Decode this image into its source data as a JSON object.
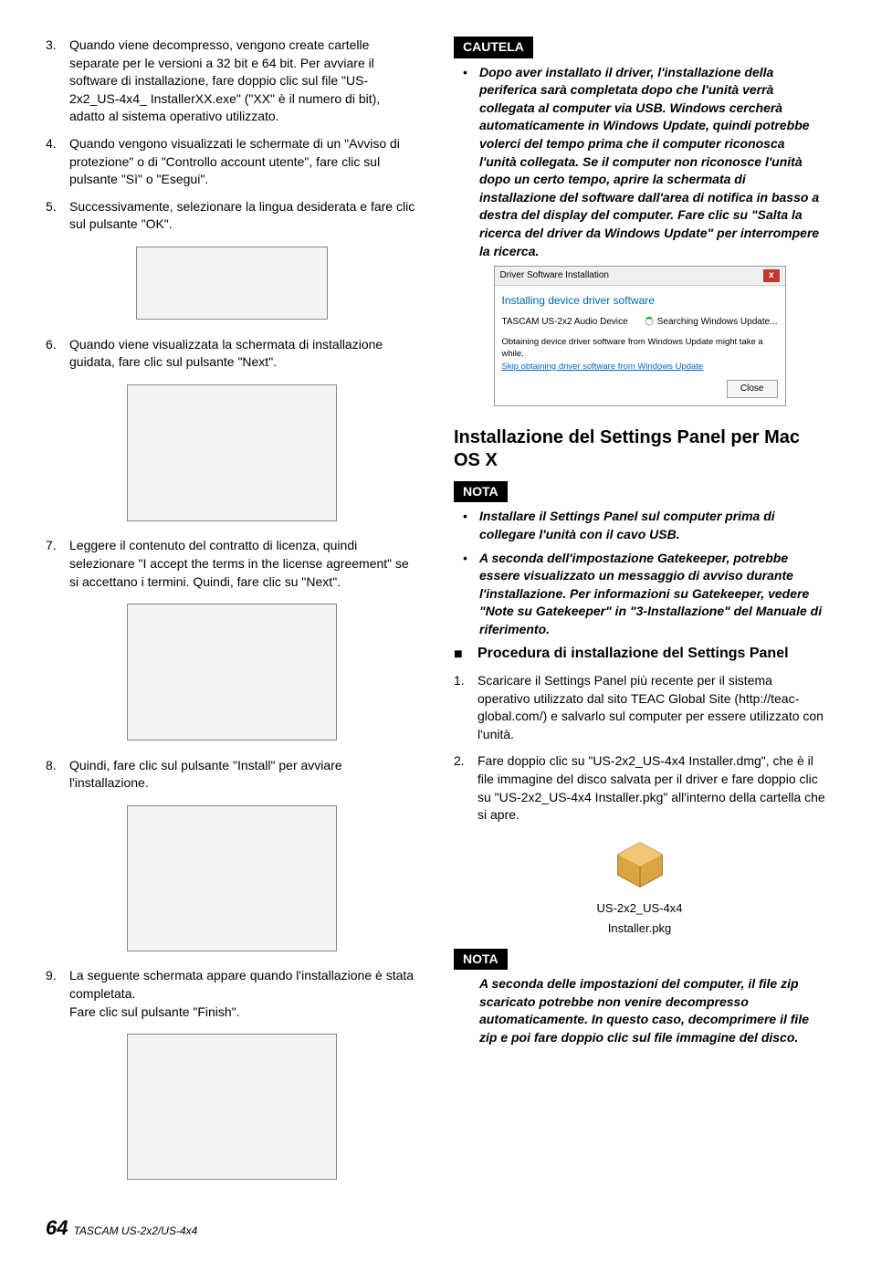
{
  "left": {
    "step3": {
      "n": "3.",
      "t": "Quando viene decompresso, vengono create cartelle separate per le versioni a 32 bit e 64 bit. Per avviare il software di installazione, fare doppio clic sul file \"US-2x2_US-4x4_ InstallerXX.exe\" (\"XX\" è il numero di bit), adatto al sistema operativo utilizzato."
    },
    "step4": {
      "n": "4.",
      "t": "Quando vengono visualizzati le schermate di un \"Avviso di protezione\" o di \"Controllo account utente\", fare clic sul pulsante \"Sì\" o \"Esegui\"."
    },
    "step5": {
      "n": "5.",
      "t": "Successivamente, selezionare la lingua desiderata e fare clic sul pulsante \"OK\"."
    },
    "step6": {
      "n": "6.",
      "t": "Quando viene visualizzata la schermata di installazione guidata, fare clic sul pulsante \"Next\"."
    },
    "step7": {
      "n": "7.",
      "t": "Leggere il contenuto del contratto di licenza, quindi selezionare  \"I accept the terms in the license agreement\" se si accettano i termini. Quindi, fare clic su \"Next\"."
    },
    "step8": {
      "n": "8.",
      "t": "Quindi, fare clic sul pulsante \"Install\" per avviare l'installazione."
    },
    "step9a": {
      "n": "9.",
      "t": "La seguente schermata appare quando l'installazione è stata completata."
    },
    "step9b": "Fare clic sul pulsante \"Finish\"."
  },
  "right": {
    "cautela_tag": "CAUTELA",
    "cautela_text": "Dopo aver installato il driver, l'installazione della periferica sarà completata dopo che l'unità verrà collegata al computer via USB. Windows cercherà automaticamente in Windows Update, quindi potrebbe volerci del tempo prima che il computer riconosca l'unità collegata. Se il computer non riconosce l'unità dopo un certo tempo, aprire la schermata di installazione del software dall'area di notifica in basso a destra del display del computer. Fare clic su \"Salta la ricerca del driver da Windows Update\" per interrompere la ricerca.",
    "driver": {
      "title": "Driver Software Installation",
      "heading": "Installing device driver software",
      "device": "TASCAM US-2x2 Audio Device",
      "status": "Searching Windows Update...",
      "msg": "Obtaining device driver software from Windows Update might take a while.",
      "link": "Skip obtaining driver software from Windows Update",
      "close": "Close"
    },
    "section_title": "Installazione del Settings Panel per Mac OS X",
    "nota_tag": "NOTA",
    "nota1_b1": "Installare il Settings Panel sul computer prima di collegare l'unità con il cavo USB.",
    "nota1_b2": "A seconda dell'impostazione Gatekeeper, potrebbe essere visualizzato un messaggio di avviso durante l'installazione. Per informazioni su Gatekeeper, vedere \"Note su Gatekeeper\" in \"3-Installazione\" del Manuale di riferimento.",
    "sub_title": "Procedura di installazione del Settings Panel",
    "mac1": {
      "n": "1.",
      "t": "Scaricare il Settings Panel più recente per il sistema operativo utilizzato dal sito TEAC Global Site (http://teac-global.com/) e salvarlo sul computer per essere utilizzato con l'unità."
    },
    "mac2": {
      "n": "2.",
      "t": "Fare doppio clic su \"US-2x2_US-4x4 Installer.dmg\", che è il file immagine del disco salvata per il driver e fare doppio clic su \"US-2x2_US-4x4 Installer.pkg\" all'interno della cartella che si apre."
    },
    "pkg_caption_l1": "US-2x2_US-4x4",
    "pkg_caption_l2": "Installer.pkg",
    "nota2_text": "A seconda delle impostazioni del computer, il file zip scaricato potrebbe non venire decompresso automaticamente. In questo caso, decomprimere il file zip e poi fare doppio clic sul file immagine del disco."
  },
  "footer": {
    "page": "64",
    "model": "TASCAM US-2x2/US-4x4"
  }
}
